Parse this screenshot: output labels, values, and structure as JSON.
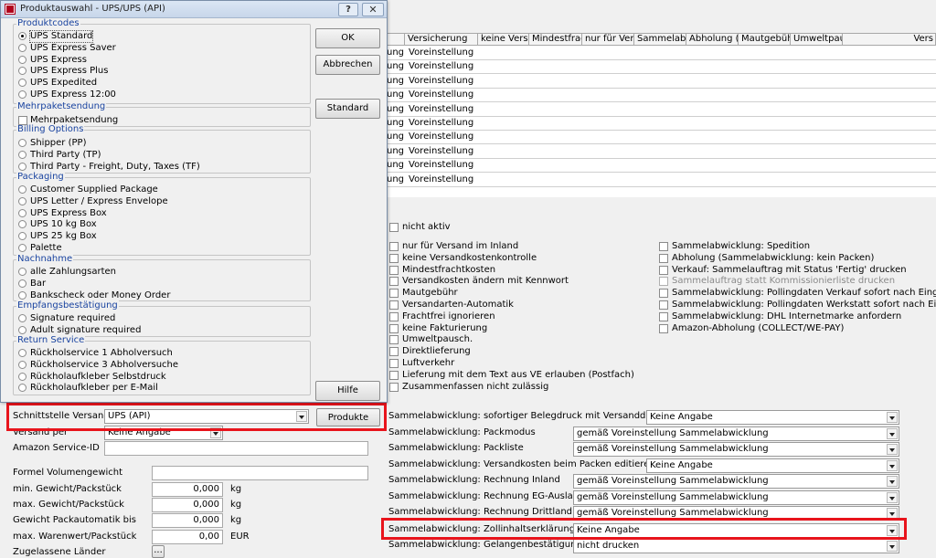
{
  "dialog": {
    "title": "Produktauswahl - UPS/UPS (API)",
    "produktcodes": {
      "title": "Produktcodes",
      "items": [
        "UPS Standard",
        "UPS Express Saver",
        "UPS Express",
        "UPS Express Plus",
        "UPS Expedited",
        "UPS Express 12:00"
      ]
    },
    "mehrpaket": {
      "title": "Mehrpaketsendung",
      "items": [
        "Mehrpaketsendung"
      ]
    },
    "billing": {
      "title": "Billing Options",
      "items": [
        "Shipper (PP)",
        "Third Party (TP)",
        "Third Party - Freight, Duty, Taxes (TF)"
      ]
    },
    "packaging": {
      "title": "Packaging",
      "items": [
        "Customer Supplied Package",
        "UPS Letter / Express Envelope",
        "UPS Express Box",
        "UPS 10 kg Box",
        "UPS 25 kg Box",
        "Palette"
      ]
    },
    "nachnahme": {
      "title": "Nachnahme",
      "items": [
        "alle Zahlungsarten",
        "Bar",
        "Bankscheck oder Money Order"
      ]
    },
    "empfang": {
      "title": "Empfangsbestätigung",
      "items": [
        "Signature required",
        "Adult signature required"
      ]
    },
    "return": {
      "title": "Return Service",
      "items": [
        "Rückholservice 1 Abholversuch",
        "Rückholservice 3 Abholversuche",
        "Rückholaufkleber Selbstdruck",
        "Rückholaufkleber per E-Mail"
      ]
    },
    "buttons": {
      "ok": "OK",
      "abbrechen": "Abbrechen",
      "standard": "Standard",
      "hilfe": "Hilfe"
    }
  },
  "grid": {
    "columns": [
      "Versicherung",
      "keine Versand",
      "Mindestfrach",
      "nur für Vers",
      "Sammelabw",
      "Abholung (S",
      "Mautgebühr",
      "Umweltpaus",
      "Vers"
    ],
    "left_cell": "ung",
    "row_value": "Voreinstellung",
    "row_count": 10
  },
  "options": {
    "nicht_aktiv": "nicht aktiv",
    "left": [
      "nur für Versand im Inland",
      "keine Versandkostenkontrolle",
      "Mindestfrachtkosten",
      "Versandkosten ändern mit Kennwort",
      "Mautgebühr",
      "Versandarten-Automatik",
      "Frachtfrei ignorieren",
      "keine Fakturierung",
      "Umweltpausch.",
      "Direktlieferung",
      "Luftverkehr",
      "Lieferung mit dem Text aus VE erlauben (Postfach)",
      "Zusammenfassen nicht zulässig"
    ],
    "right": [
      "Sammelabwicklung: Spedition",
      "Abholung (Sammelabwicklung: kein Packen)",
      "Verkauf: Sammelauftrag mit Status 'Fertig' drucken",
      "Sammelauftrag statt Kommissionierliste drucken",
      "Sammelabwicklung: Pollingdaten Verkauf sofort nach Eingabe F",
      "Sammelabwicklung: Pollingdaten Werkstatt sofort nach Eingabe",
      "Sammelabwicklung: DHL Internetmarke anfordern",
      "Amazon-Abholung (COLLECT/WE-PAY)"
    ]
  },
  "settings": [
    {
      "label": "Sammelabwicklung: sofortiger Belegdruck mit Versanddaten",
      "value": "Keine Angabe"
    },
    {
      "label": "Sammelabwicklung: Packmodus",
      "value": "gemäß Voreinstellung Sammelabwicklung"
    },
    {
      "label": "Sammelabwicklung: Packliste",
      "value": "gemäß Voreinstellung Sammelabwicklung"
    },
    {
      "label": "Sammelabwicklung: Versandkosten beim Packen editieren",
      "value": "Keine Angabe"
    },
    {
      "label": "Sammelabwicklung: Rechnung Inland",
      "value": "gemäß Voreinstellung Sammelabwicklung"
    },
    {
      "label": "Sammelabwicklung: Rechnung EG-Ausland",
      "value": "gemäß Voreinstellung Sammelabwicklung"
    },
    {
      "label": "Sammelabwicklung: Rechnung Drittland",
      "value": "gemäß Voreinstellung Sammelabwicklung"
    },
    {
      "label": "Sammelabwicklung: Zollinhaltserklärung",
      "value": "Keine Angabe"
    },
    {
      "label": "Sammelabwicklung: Gelangenbestätigung",
      "value": "nicht drucken"
    }
  ],
  "left_form": {
    "schnittstelle_label": "Schnittstelle Versand",
    "schnittstelle_value": "UPS (API)",
    "produkte_button": "Produkte",
    "versand_per_label": "Versand per",
    "versand_per_value": "Keine Angabe",
    "amazon_label": "Amazon Service-ID",
    "formel_label": "Formel Volumengewicht",
    "min_label": "min. Gewicht/Packstück",
    "min_value": "0,000",
    "max_label": "max. Gewicht/Packstück",
    "max_value": "0,000",
    "auto_label": "Gewicht Packautomatik bis",
    "auto_value": "0,000",
    "warenwert_label": "max. Warenwert/Packstück",
    "warenwert_value": "0,00",
    "unit_kg": "kg",
    "unit_eur": "EUR",
    "laender_label": "Zugelassene Länder",
    "laender_button": "..."
  },
  "colors": {
    "highlight": "#e8141c",
    "group_title": "#1a44a0"
  }
}
